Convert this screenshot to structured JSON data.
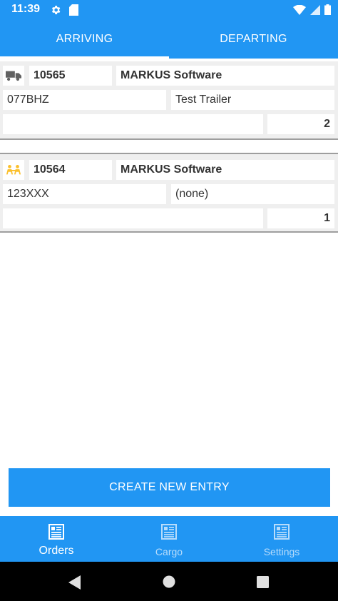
{
  "status_bar": {
    "time": "11:39"
  },
  "tabs": [
    {
      "label": "ARRIVING",
      "active": true
    },
    {
      "label": "DEPARTING",
      "active": false
    }
  ],
  "entries": [
    {
      "icon": "truck-icon",
      "order_number": "10565",
      "company": "MARKUS Software",
      "plate": "077BHZ",
      "trailer": "Test Trailer",
      "note": "",
      "count": "2"
    },
    {
      "icon": "people-icon",
      "order_number": "10564",
      "company": "MARKUS Software",
      "plate": "123XXX",
      "trailer": "(none)",
      "note": "",
      "count": "1"
    }
  ],
  "create_button": {
    "label": "CREATE NEW ENTRY"
  },
  "bottom_nav": [
    {
      "label": "Orders",
      "active": true
    },
    {
      "label": "Cargo",
      "active": false
    },
    {
      "label": "Settings",
      "active": false
    }
  ],
  "colors": {
    "primary": "#2196f3",
    "people_icon": "#fbc02d",
    "truck_icon": "#616161"
  }
}
